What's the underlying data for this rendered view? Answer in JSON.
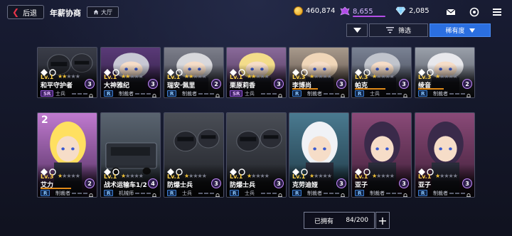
{
  "header": {
    "back_label": "后退",
    "title": "年薪协商",
    "home_label": "大厅",
    "gold": "460,874",
    "purple_gems": "8,655",
    "diamonds": "2,085"
  },
  "filters": {
    "filter_label": "筛选",
    "sort_label": "稀有度"
  },
  "cards": [
    {
      "name": "和平守护者",
      "lv": "Lv.1",
      "stars": 2,
      "level": "3",
      "rarity": "SR",
      "unit": "士兵",
      "art": "mech-dark",
      "bar": 0
    },
    {
      "name": "大神雅纪",
      "lv": "Lv.1",
      "stars": 2,
      "level": "3",
      "rarity": "R",
      "unit": "制裁者",
      "art": "char-purple",
      "bar": 0
    },
    {
      "name": "瑞安·佩里",
      "lv": "Lv.1",
      "stars": 2,
      "level": "2",
      "rarity": "R",
      "unit": "制裁者",
      "art": "char-suit",
      "bar": 0
    },
    {
      "name": "栗原莉香",
      "lv": "Lv.1",
      "stars": 2,
      "level": "3",
      "rarity": "SR",
      "unit": "士兵",
      "art": "char-blonde",
      "bar": 0
    },
    {
      "name": "李博尚",
      "lv": "Lv.3",
      "stars": 1,
      "level": "3",
      "rarity": "R",
      "unit": "制裁者",
      "art": "char-bald",
      "bar": 0.5
    },
    {
      "name": "帕克",
      "lv": "Lv.3",
      "stars": 1,
      "level": "3",
      "rarity": "R",
      "unit": "士兵",
      "art": "char-gray",
      "bar": 0.6
    },
    {
      "name": "绫音",
      "lv": "Lv.3",
      "stars": 1,
      "level": "2",
      "rarity": "R",
      "unit": "制裁者",
      "art": "char-white",
      "bar": 0.5
    },
    {
      "name": "艾力",
      "lv": "Lv.3",
      "stars": 1,
      "level": "2",
      "rarity": "R",
      "unit": "制裁者",
      "art": "char-yellow",
      "bar": 0.6,
      "copies": "2"
    },
    {
      "name": "战术运输车1/2",
      "lv": "Lv.1",
      "stars": 1,
      "level": "4",
      "rarity": "R",
      "unit": "机械师",
      "art": "truck",
      "bar": 0
    },
    {
      "name": "防爆士兵",
      "lv": "Lv.1",
      "stars": 1,
      "level": "3",
      "rarity": "R",
      "unit": "士兵",
      "art": "riot",
      "bar": 0
    },
    {
      "name": "防爆士兵",
      "lv": "Lv.1",
      "stars": 1,
      "level": "3",
      "rarity": "R",
      "unit": "士兵",
      "art": "riot",
      "bar": 0
    },
    {
      "name": "克劳迪娅",
      "lv": "Lv.1",
      "stars": 1,
      "level": "3",
      "rarity": "R",
      "unit": "制裁者",
      "art": "char-silver",
      "bar": 0
    },
    {
      "name": "亚子",
      "lv": "Lv.1",
      "stars": 1,
      "level": "3",
      "rarity": "R",
      "unit": "制裁者",
      "art": "char-twin",
      "bar": 0
    },
    {
      "name": "亚子",
      "lv": "Lv.1",
      "stars": 1,
      "level": "3",
      "rarity": "R",
      "unit": "制裁者",
      "art": "char-twin",
      "bar": 0
    }
  ],
  "footer": {
    "owned_label": "已拥有",
    "owned_count": "84/200",
    "plus": "+"
  }
}
